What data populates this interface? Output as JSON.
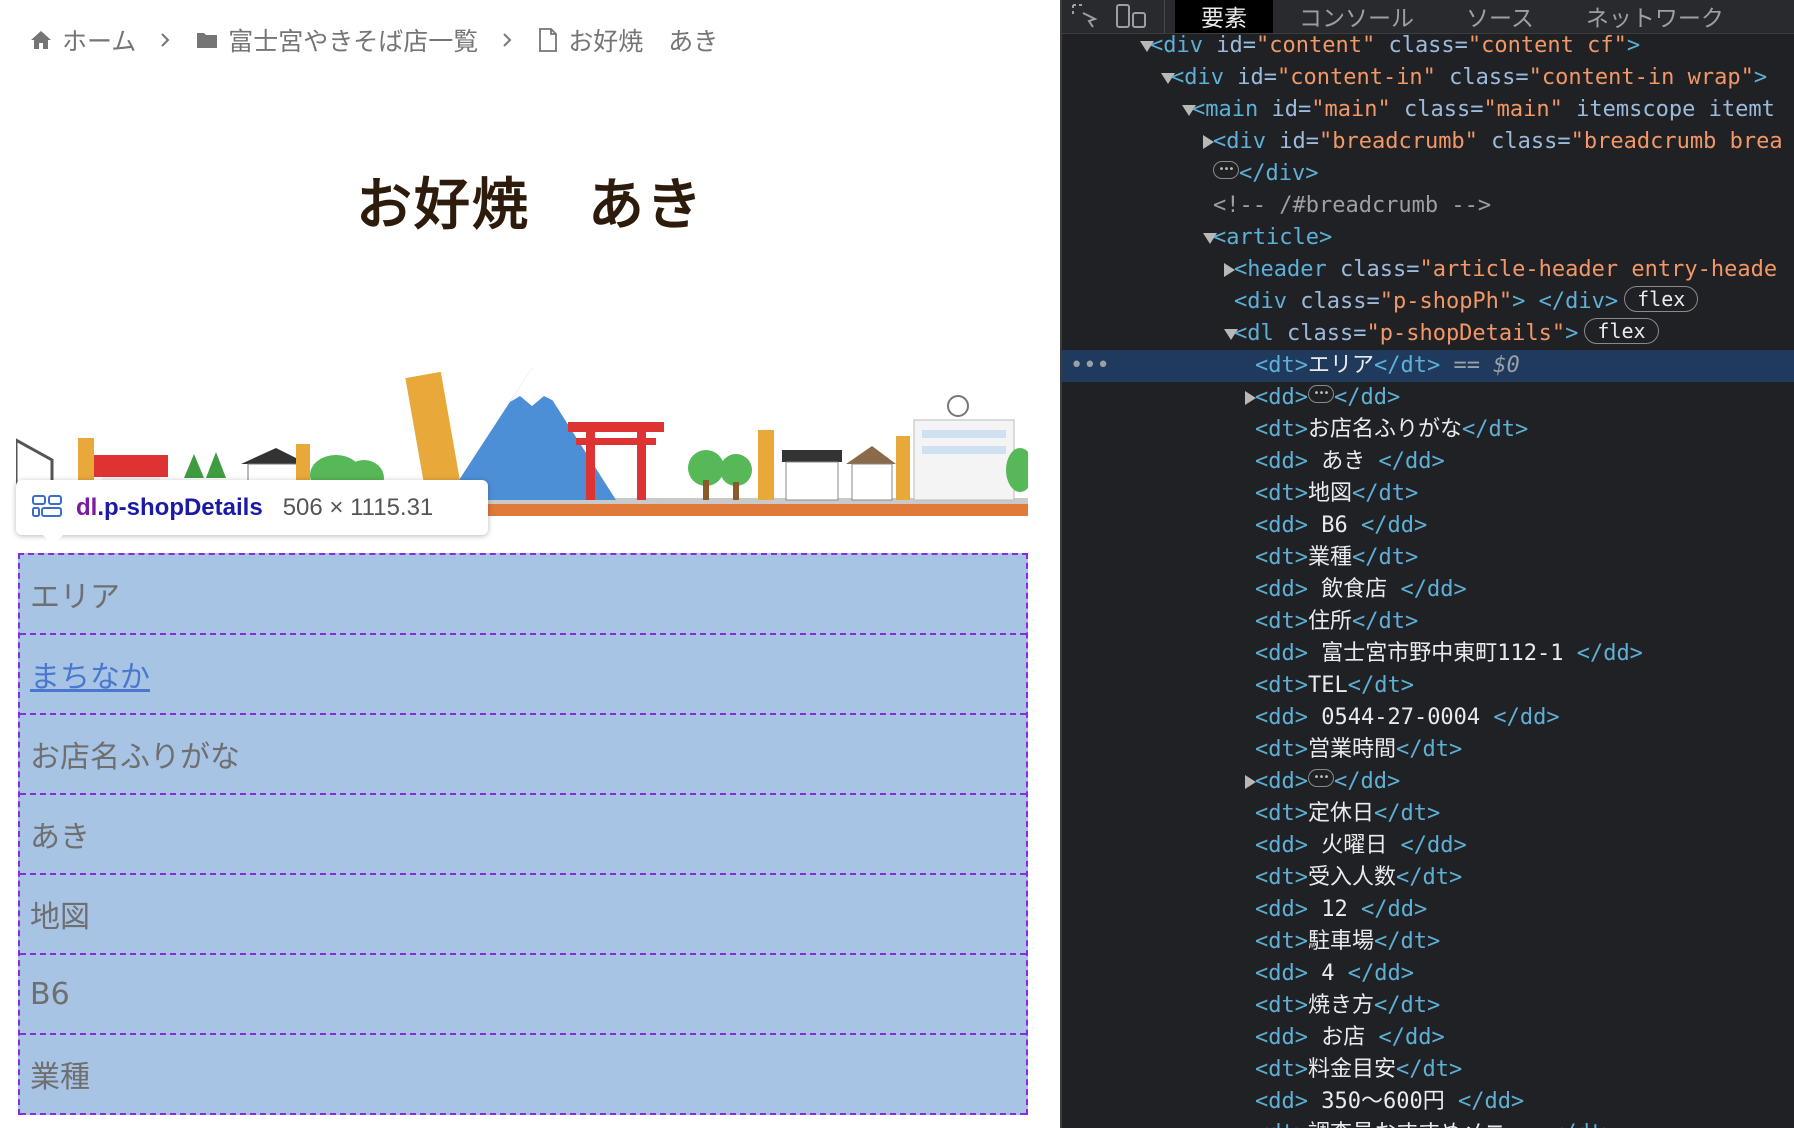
{
  "breadcrumb": {
    "items": [
      {
        "icon": "home-icon",
        "label": "ホーム"
      },
      {
        "icon": "folder-icon",
        "label": "富士宮やきそば店一覧"
      },
      {
        "icon": "document-icon",
        "label": "お好焼　あき"
      }
    ]
  },
  "entry_title": "お好焼　あき",
  "inspector_tooltip": {
    "icon": "flex-container-icon",
    "tag": "dl",
    "class_name": ".p-shopDetails",
    "size": "506 × 1115.31"
  },
  "shop_details": {
    "rows": [
      {
        "text": "エリア",
        "is_link": false
      },
      {
        "text": "まちなか",
        "is_link": true
      },
      {
        "text": "お店名ふりがな",
        "is_link": false
      },
      {
        "text": "あき",
        "is_link": false
      },
      {
        "text": "地図",
        "is_link": false
      },
      {
        "text": "B6",
        "is_link": false
      },
      {
        "text": "業種",
        "is_link": false
      }
    ]
  },
  "devtools": {
    "toolbar": {
      "tools": [
        "inspect-element-icon",
        "device-toolbar-icon"
      ],
      "tabs": [
        {
          "label": "要素",
          "active": true
        },
        {
          "label": "コンソール",
          "active": false
        },
        {
          "label": "ソース",
          "active": false
        },
        {
          "label": "ネットワーク",
          "active": false
        }
      ]
    },
    "dom_lines": [
      {
        "indent": 0,
        "twisty": "open",
        "parts": [
          [
            "t",
            "<div "
          ],
          [
            "a",
            "id="
          ],
          [
            "v",
            "\"content\""
          ],
          [
            "a",
            " class="
          ],
          [
            "v",
            "\"content cf\""
          ],
          [
            "t",
            ">"
          ]
        ]
      },
      {
        "indent": 1,
        "twisty": "open",
        "parts": [
          [
            "t",
            "<div "
          ],
          [
            "a",
            "id="
          ],
          [
            "v",
            "\"content-in\""
          ],
          [
            "a",
            " class="
          ],
          [
            "v",
            "\"content-in wrap\""
          ],
          [
            "t",
            ">"
          ]
        ]
      },
      {
        "indent": 2,
        "twisty": "open",
        "parts": [
          [
            "t",
            "<main "
          ],
          [
            "a",
            "id="
          ],
          [
            "v",
            "\"main\""
          ],
          [
            "a",
            " class="
          ],
          [
            "v",
            "\"main\""
          ],
          [
            "a",
            " itemscope itemt"
          ]
        ]
      },
      {
        "indent": 3,
        "twisty": "closed",
        "parts": [
          [
            "t",
            "<div "
          ],
          [
            "a",
            "id="
          ],
          [
            "v",
            "\"breadcrumb\""
          ],
          [
            "a",
            " class="
          ],
          [
            "v",
            "\"breadcrumb brea"
          ]
        ]
      },
      {
        "indent": 3,
        "twisty": "none",
        "dots": true,
        "parts": [
          [
            "t",
            "</div>"
          ]
        ]
      },
      {
        "indent": 3,
        "twisty": "none",
        "parts": [
          [
            "c",
            "<!-- /#breadcrumb -->"
          ]
        ]
      },
      {
        "indent": 3,
        "twisty": "open",
        "parts": [
          [
            "t",
            "<article>"
          ]
        ]
      },
      {
        "indent": 4,
        "twisty": "closed",
        "parts": [
          [
            "t",
            "<header "
          ],
          [
            "a",
            "class="
          ],
          [
            "v",
            "\"article-header entry-heade"
          ]
        ]
      },
      {
        "indent": 4,
        "twisty": "none",
        "pill": "flex",
        "parts": [
          [
            "t",
            "<div "
          ],
          [
            "a",
            "class="
          ],
          [
            "v",
            "\"p-shopPh\""
          ],
          [
            "t",
            "> </div>"
          ]
        ]
      },
      {
        "indent": 4,
        "twisty": "open",
        "pill": "flex",
        "parts": [
          [
            "t",
            "<dl "
          ],
          [
            "a",
            "class="
          ],
          [
            "v",
            "\"p-shopDetails\""
          ],
          [
            "t",
            ">"
          ]
        ]
      },
      {
        "indent": 5,
        "twisty": "none",
        "selected": true,
        "suffix": "== $0",
        "parts": [
          [
            "t",
            "<dt>"
          ],
          [
            "tx",
            "エリア"
          ],
          [
            "t",
            "</dt>"
          ]
        ]
      },
      {
        "indent": 5,
        "twisty": "closed",
        "dots_mid": true,
        "parts": [
          [
            "t",
            "<dd>"
          ],
          [
            "t",
            "</dd>"
          ]
        ]
      },
      {
        "indent": 5,
        "twisty": "none",
        "parts": [
          [
            "t",
            "<dt>"
          ],
          [
            "tx",
            "お店名ふりがな"
          ],
          [
            "t",
            "</dt>"
          ]
        ]
      },
      {
        "indent": 5,
        "twisty": "none",
        "parts": [
          [
            "t",
            "<dd>"
          ],
          [
            "tx",
            " あき "
          ],
          [
            "t",
            "</dd>"
          ]
        ]
      },
      {
        "indent": 5,
        "twisty": "none",
        "parts": [
          [
            "t",
            "<dt>"
          ],
          [
            "tx",
            "地図"
          ],
          [
            "t",
            "</dt>"
          ]
        ]
      },
      {
        "indent": 5,
        "twisty": "none",
        "parts": [
          [
            "t",
            "<dd>"
          ],
          [
            "tx",
            " B6 "
          ],
          [
            "t",
            "</dd>"
          ]
        ]
      },
      {
        "indent": 5,
        "twisty": "none",
        "parts": [
          [
            "t",
            "<dt>"
          ],
          [
            "tx",
            "業種"
          ],
          [
            "t",
            "</dt>"
          ]
        ]
      },
      {
        "indent": 5,
        "twisty": "none",
        "parts": [
          [
            "t",
            "<dd>"
          ],
          [
            "tx",
            " 飲食店 "
          ],
          [
            "t",
            "</dd>"
          ]
        ]
      },
      {
        "indent": 5,
        "twisty": "none",
        "parts": [
          [
            "t",
            "<dt>"
          ],
          [
            "tx",
            "住所"
          ],
          [
            "t",
            "</dt>"
          ]
        ]
      },
      {
        "indent": 5,
        "twisty": "none",
        "parts": [
          [
            "t",
            "<dd>"
          ],
          [
            "tx",
            " 富士宮市野中東町112-1 "
          ],
          [
            "t",
            "</dd>"
          ]
        ]
      },
      {
        "indent": 5,
        "twisty": "none",
        "parts": [
          [
            "t",
            "<dt>"
          ],
          [
            "tx",
            "TEL"
          ],
          [
            "t",
            "</dt>"
          ]
        ]
      },
      {
        "indent": 5,
        "twisty": "none",
        "parts": [
          [
            "t",
            "<dd>"
          ],
          [
            "tx",
            " 0544-27-0004 "
          ],
          [
            "t",
            "</dd>"
          ]
        ]
      },
      {
        "indent": 5,
        "twisty": "none",
        "parts": [
          [
            "t",
            "<dt>"
          ],
          [
            "tx",
            "営業時間"
          ],
          [
            "t",
            "</dt>"
          ]
        ]
      },
      {
        "indent": 5,
        "twisty": "closed",
        "dots_mid": true,
        "parts": [
          [
            "t",
            "<dd>"
          ],
          [
            "t",
            "</dd>"
          ]
        ]
      },
      {
        "indent": 5,
        "twisty": "none",
        "parts": [
          [
            "t",
            "<dt>"
          ],
          [
            "tx",
            "定休日"
          ],
          [
            "t",
            "</dt>"
          ]
        ]
      },
      {
        "indent": 5,
        "twisty": "none",
        "parts": [
          [
            "t",
            "<dd>"
          ],
          [
            "tx",
            " 火曜日 "
          ],
          [
            "t",
            "</dd>"
          ]
        ]
      },
      {
        "indent": 5,
        "twisty": "none",
        "parts": [
          [
            "t",
            "<dt>"
          ],
          [
            "tx",
            "受入人数"
          ],
          [
            "t",
            "</dt>"
          ]
        ]
      },
      {
        "indent": 5,
        "twisty": "none",
        "parts": [
          [
            "t",
            "<dd>"
          ],
          [
            "tx",
            " 12 "
          ],
          [
            "t",
            "</dd>"
          ]
        ]
      },
      {
        "indent": 5,
        "twisty": "none",
        "parts": [
          [
            "t",
            "<dt>"
          ],
          [
            "tx",
            "駐車場"
          ],
          [
            "t",
            "</dt>"
          ]
        ]
      },
      {
        "indent": 5,
        "twisty": "none",
        "parts": [
          [
            "t",
            "<dd>"
          ],
          [
            "tx",
            " 4 "
          ],
          [
            "t",
            "</dd>"
          ]
        ]
      },
      {
        "indent": 5,
        "twisty": "none",
        "parts": [
          [
            "t",
            "<dt>"
          ],
          [
            "tx",
            "焼き方"
          ],
          [
            "t",
            "</dt>"
          ]
        ]
      },
      {
        "indent": 5,
        "twisty": "none",
        "parts": [
          [
            "t",
            "<dd>"
          ],
          [
            "tx",
            " お店 "
          ],
          [
            "t",
            "</dd>"
          ]
        ]
      },
      {
        "indent": 5,
        "twisty": "none",
        "parts": [
          [
            "t",
            "<dt>"
          ],
          [
            "tx",
            "料金目安"
          ],
          [
            "t",
            "</dt>"
          ]
        ]
      },
      {
        "indent": 5,
        "twisty": "none",
        "parts": [
          [
            "t",
            "<dd>"
          ],
          [
            "tx",
            " 350〜600円 "
          ],
          [
            "t",
            "</dd>"
          ]
        ]
      },
      {
        "indent": 5,
        "twisty": "none",
        "parts": [
          [
            "t",
            "<dt>"
          ],
          [
            "tx",
            "調査員おすすめメニュー"
          ],
          [
            "t",
            "</dt>"
          ]
        ]
      }
    ],
    "selected_row_gutter": "•••"
  },
  "colors": {
    "title": "#2d1c0c",
    "highlight_overlay": "#a7c4e5",
    "overlay_border": "#8a2be2",
    "link": "#4a78cf",
    "devtools_bg": "#202124",
    "selected_row": "#1f3a5c"
  }
}
